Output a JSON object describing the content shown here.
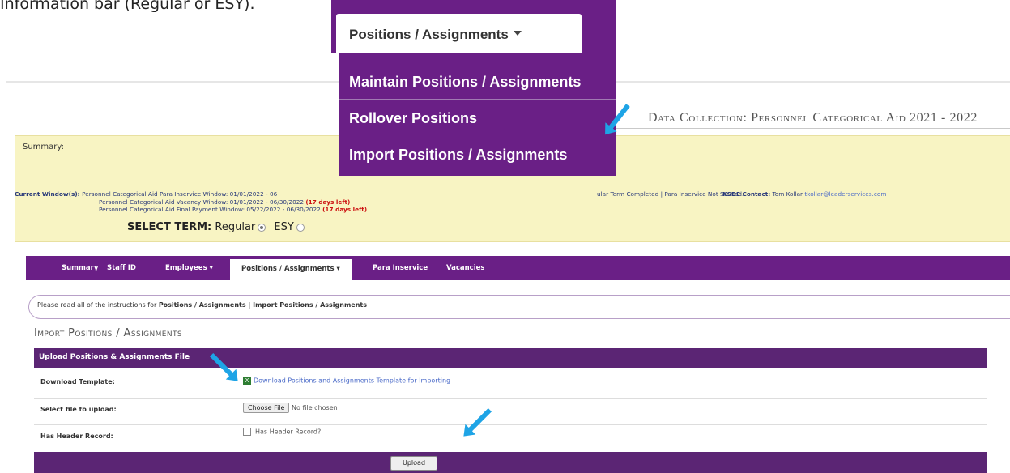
{
  "doc_text": "Information bar (Regular or ESY).",
  "header": {
    "data_collection_title": "Data Collection: Personnel Categorical Aid 2021 - 2022"
  },
  "summary": {
    "label": "Summary:",
    "current_window_label": "Current Window(s):",
    "windows": [
      {
        "text": "Personnel Categorical Aid Para Inservice Window: 01/01/2022 - 06",
        "days": ""
      },
      {
        "text": "Personnel Categorical Aid Vacancy Window: 01/01/2022 - 06/30/2022",
        "days": "(17 days left)"
      },
      {
        "text": "Personnel Categorical Aid Final Payment Window: 05/22/2022 - 06/30/2022",
        "days": "(17 days left)"
      }
    ],
    "status_text": "ular Term Completed | Para Inservice Not Started.",
    "contact_label": "KSDE Contact:",
    "contact_name": "Tom Kollar",
    "contact_email": "tkollar@leaderservices.com",
    "select_term_label": "SELECT TERM:",
    "term_options": [
      "Regular",
      "ESY"
    ],
    "selected_term": "Regular"
  },
  "nav": {
    "items": [
      "Summary",
      "Staff ID",
      "Employees ▾",
      "Positions / Assignments ▾",
      "Para Inservice",
      "Vacancies"
    ],
    "active": "Positions / Assignments ▾"
  },
  "instructions": {
    "prefix": "Please read all of the instructions for ",
    "bold": "Positions / Assignments | Import Positions / Assignments"
  },
  "import_section": {
    "title": "Import Positions / Assignments",
    "panel_title": "Upload Positions & Assignments File",
    "rows": {
      "download_label": "Download Template:",
      "download_link": "Download Positions and Assignments Template for Importing",
      "select_label": "Select file to upload:",
      "choose_file_button": "Choose File",
      "no_file_text": "No file chosen",
      "header_label": "Has Header Record:",
      "header_checkbox_label": "Has Header Record?"
    },
    "upload_button": "Upload"
  },
  "dropdown": {
    "tab_label": "Positions / Assignments",
    "items": [
      "Maintain Positions / Assignments",
      "Rollover Positions",
      "Import Positions / Assignments"
    ]
  },
  "colors": {
    "purple": "#6a1f86",
    "panel_purple": "#5b2574",
    "summary_yellow": "#f8f4c3",
    "arrow_blue": "#1ea4e6",
    "days_red": "#cc1111"
  }
}
